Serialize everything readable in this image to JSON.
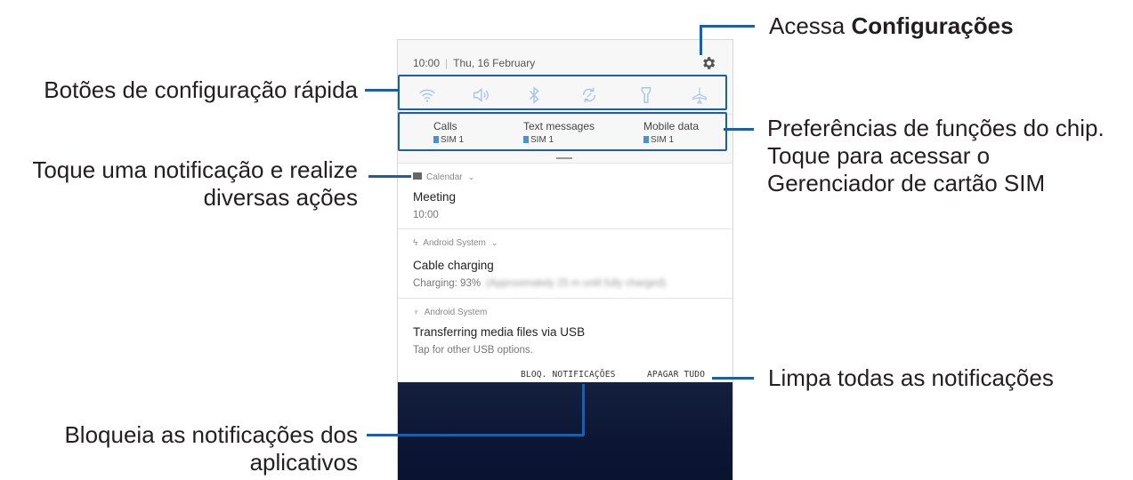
{
  "status_bar": {
    "time": "10:00",
    "date": "Thu, 16 February"
  },
  "quick_settings": {
    "buttons": [
      "wifi-icon",
      "sound-icon",
      "bluetooth-icon",
      "auto-rotate-icon",
      "flashlight-icon",
      "airplane-mode-icon"
    ]
  },
  "sim_preferences": {
    "items": [
      {
        "label": "Calls",
        "sim": "SIM 1"
      },
      {
        "label": "Text messages",
        "sim": "SIM 1"
      },
      {
        "label": "Mobile data",
        "sim": "SIM 1"
      }
    ]
  },
  "notifications": [
    {
      "app": "Calendar",
      "title": "Meeting",
      "text": "10:00",
      "text_extra": ""
    },
    {
      "app": "Android System",
      "title": "Cable charging",
      "text": "Charging: 93%",
      "text_extra": "(Approximately 25 m until fully charged)"
    },
    {
      "app": "Android System",
      "title": "Transferring media files via USB",
      "text": "Tap for other USB options.",
      "text_extra": ""
    }
  ],
  "actions": {
    "block": "BLOQ. NOTIFICAÇÕES",
    "clear": "APAGAR TUDO"
  },
  "callouts": {
    "settings_prefix": "Acessa ",
    "settings_bold": "Configurações",
    "quick_settings": "Botões de configuração rápida",
    "sim_line1": "Preferências de funções do chip.",
    "sim_line2": "Toque para acessar o",
    "sim_line3": "Gerenciador de cartão SIM",
    "notification_line1": "Toque uma notificação e realize",
    "notification_line2": "diversas ações",
    "clear_all": "Limpa todas as notificações",
    "block_line1": "Bloqueia as notificações dos",
    "block_line2": "aplicativos"
  },
  "colors": {
    "accent": "#1b5fa8",
    "sim_chip": "#4a90d9",
    "wallpaper": "#0c1634"
  }
}
